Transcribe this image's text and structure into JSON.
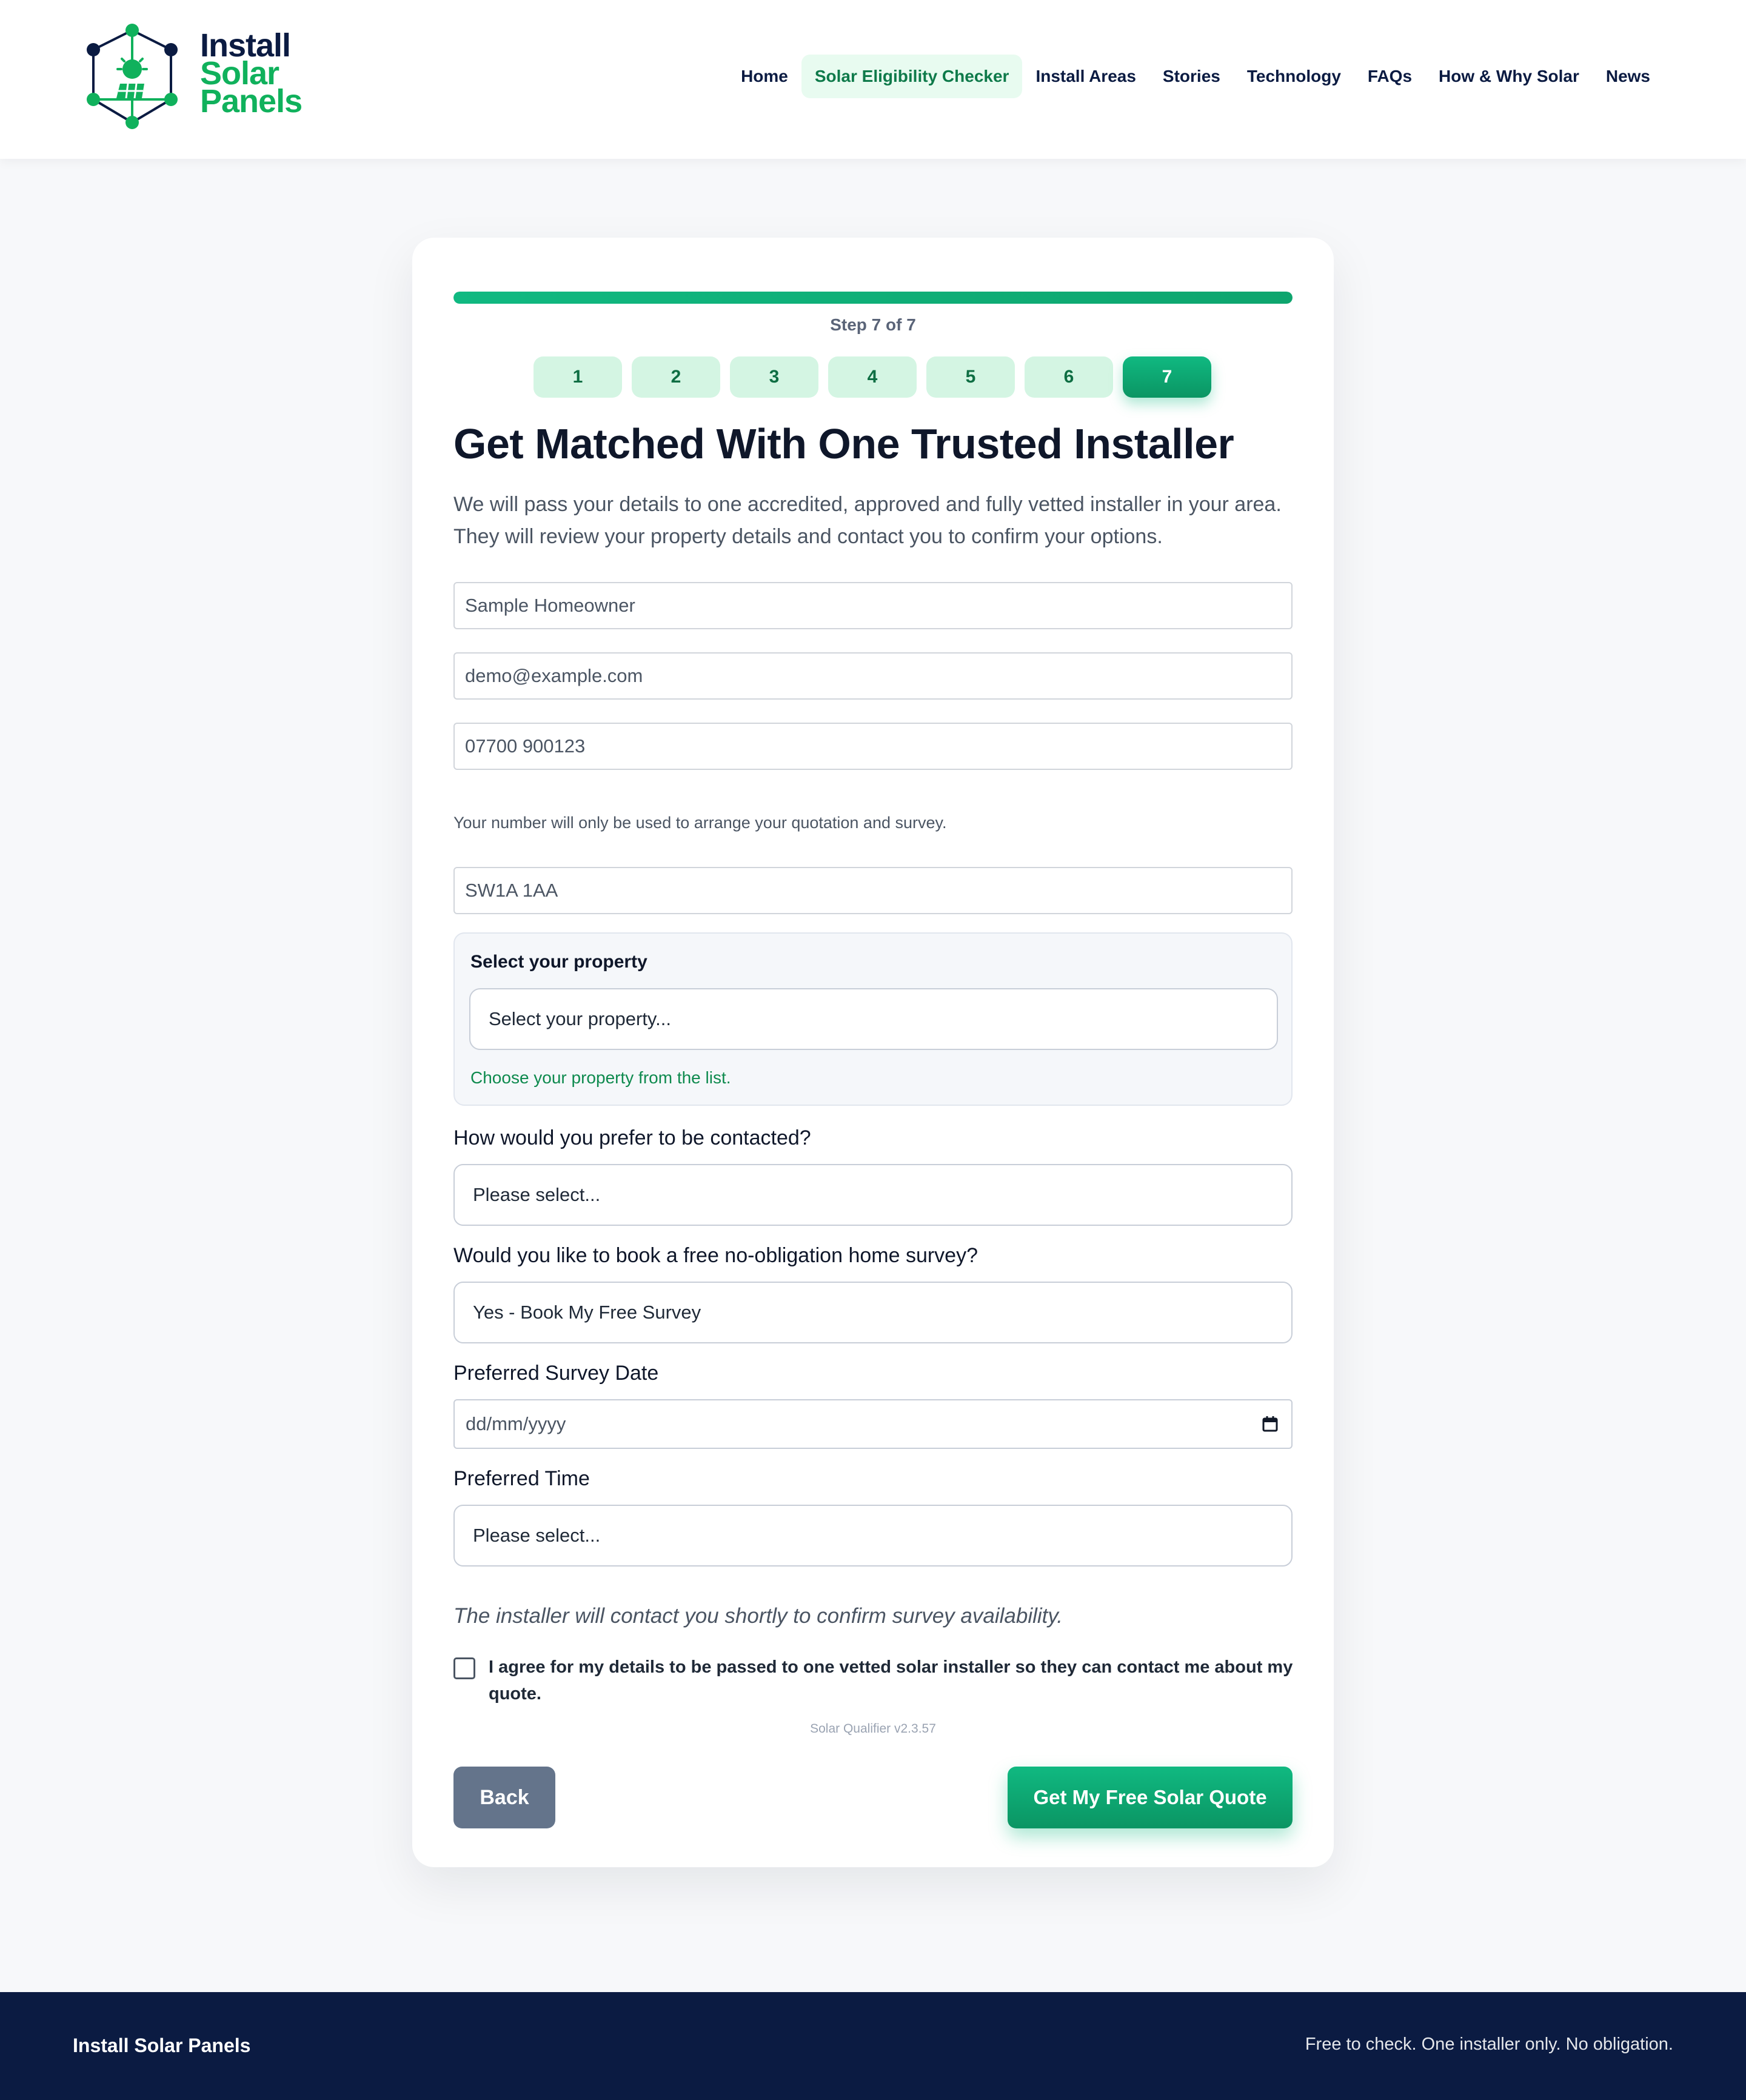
{
  "header": {
    "logo": {
      "line1": "Install",
      "line2": "Solar",
      "line3": "Panels"
    },
    "nav": [
      {
        "label": "Home"
      },
      {
        "label": "Solar Eligibility Checker",
        "active": true
      },
      {
        "label": "Install Areas"
      },
      {
        "label": "Stories"
      },
      {
        "label": "Technology"
      },
      {
        "label": "FAQs"
      },
      {
        "label": "How & Why Solar"
      },
      {
        "label": "News"
      }
    ]
  },
  "form": {
    "progress_fraction": 1.0,
    "step_label": "Step 7 of 7",
    "steps": [
      "1",
      "2",
      "3",
      "4",
      "5",
      "6",
      "7"
    ],
    "current_step": 7,
    "title": "Get Matched With One Trusted Installer",
    "intro": "We will pass your details to one accredited, approved and fully vetted installer in your area. They will review your property details and contact you to confirm your options.",
    "name_value": "Sample Homeowner",
    "email_value": "demo@example.com",
    "phone_value": "07700 900123",
    "phone_helper": "Your number will only be used to arrange your quotation and survey.",
    "postcode_value": "SW1A 1AA",
    "property": {
      "label": "Select your property",
      "select_value": "Select your property...",
      "hint": "Choose your property from the list."
    },
    "contact_question": "How would you prefer to be contacted?",
    "contact_value": "Please select...",
    "survey_question": "Would you like to book a free no-obligation home survey?",
    "survey_value": "Yes - Book My Free Survey",
    "date_label": "Preferred Survey Date",
    "date_placeholder": "dd/mm/yyyy",
    "time_label": "Preferred Time",
    "time_value": "Please select...",
    "note": "The installer will contact you shortly to confirm survey availability.",
    "consent_text": "I agree for my details to be passed to one vetted solar installer so they can contact me about my quote.",
    "consent_checked": false,
    "version": "Solar Qualifier v2.3.57",
    "back_label": "Back",
    "submit_label": "Get My Free Solar Quote"
  },
  "footer": {
    "brand": "Install Solar Panels",
    "tagline": "Free to check. One installer only. No obligation."
  },
  "colors": {
    "brand_green": "#10b981",
    "brand_navy": "#0b1b42",
    "back_button": "#64748b",
    "nav_active_bg": "#e8fbf0"
  },
  "icons": [
    "logo-hexagon-sun-icon",
    "calendar-icon"
  ]
}
